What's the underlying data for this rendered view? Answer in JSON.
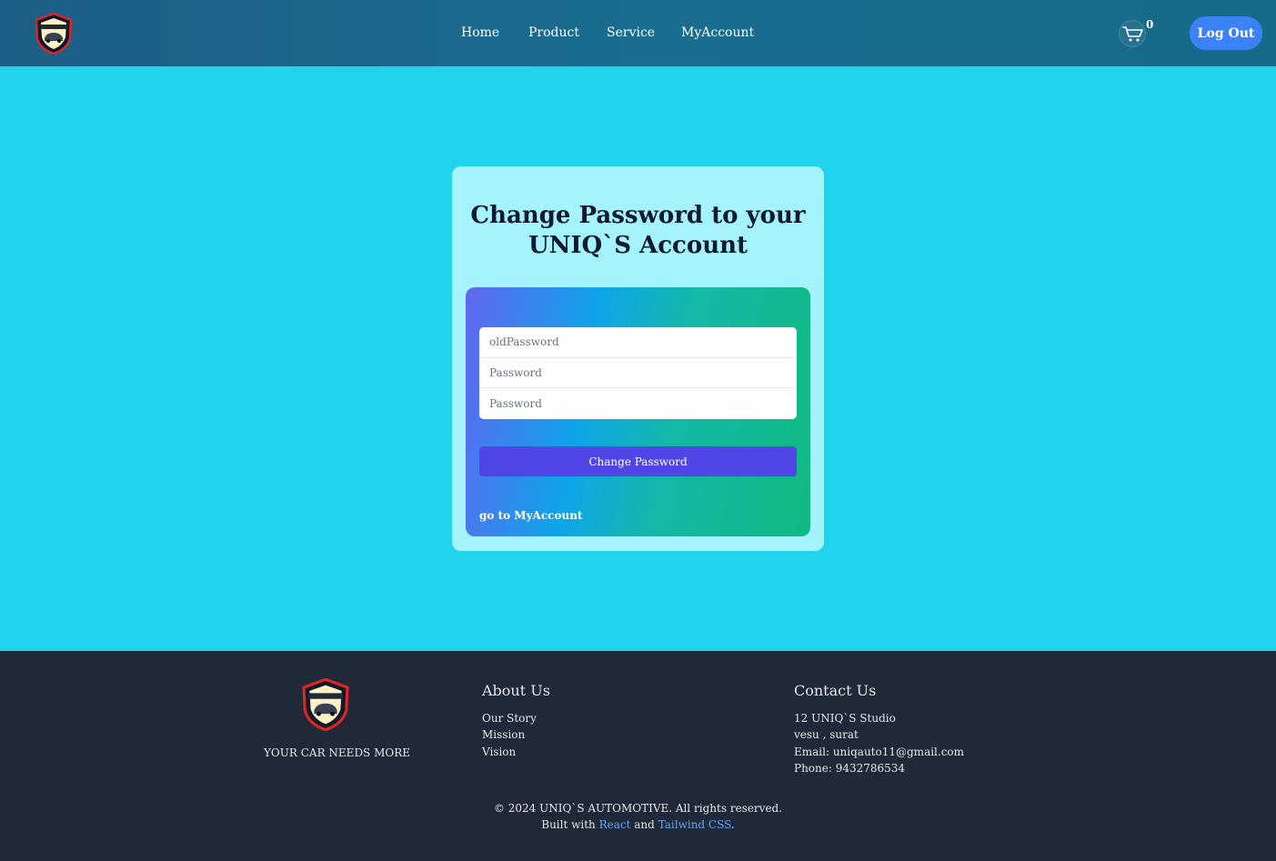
{
  "header": {
    "nav": [
      "Home",
      "Product",
      "Service",
      "MyAccount"
    ],
    "cart_count": "0",
    "logout_label": "Log Out"
  },
  "card": {
    "title_line1": "Change Password to your",
    "title_line2": "UNIQ`S Account",
    "fields": {
      "old_placeholder": "oldPassword",
      "new_placeholder": "Password",
      "confirm_placeholder": "Password"
    },
    "submit_label": "Change Password",
    "goto_link": "go to MyAccount"
  },
  "footer": {
    "tagline": "YOUR CAR NEEDS MORE",
    "about": {
      "title": "About Us",
      "items": [
        "Our Story",
        "Mission",
        "Vision"
      ]
    },
    "contact": {
      "title": "Contact Us",
      "items": [
        "12 UNIQ`S Studio",
        "vesu , surat",
        "Email: uniqauto11@gmail.com",
        "Phone: 9432786534"
      ]
    },
    "copyright": "© 2024 UNIQ`S AUTOMOTIVE. All rights reserved.",
    "built_prefix": "Built with",
    "built_react": "React",
    "built_and": "and",
    "built_tailwind": "Tailwind CSS",
    "built_suffix": "."
  },
  "colors": {
    "page_bg": "#22d3ee",
    "header_bg": "#1a6d8f",
    "card_bg": "#a5f3fc",
    "button": "#4f46e5",
    "logout": "#3b82f6",
    "footer_bg": "#1f2937"
  },
  "icons": {
    "logo": "uniqs-automotive-shield-logo",
    "cart": "cart-icon"
  }
}
